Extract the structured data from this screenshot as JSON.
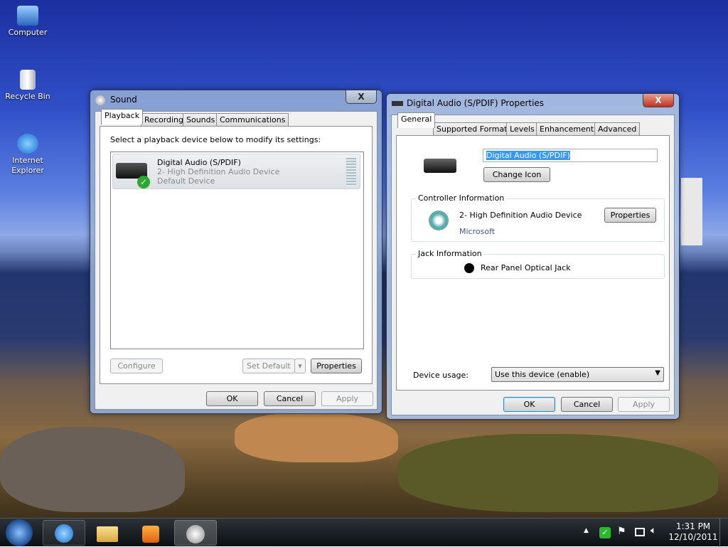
{
  "desktop": {
    "icons": [
      {
        "label": "Computer",
        "icon": "computer-icon"
      },
      {
        "label": "Recycle Bin",
        "icon": "recycle-bin-icon"
      },
      {
        "label": "Internet Explorer",
        "icon": "internet-explorer-icon"
      }
    ]
  },
  "sound": {
    "title": "Sound",
    "close": "X",
    "tabs": [
      "Playback",
      "Recording",
      "Sounds",
      "Communications"
    ],
    "instruction": "Select a playback device below to modify its settings:",
    "device": {
      "name": "Digital Audio (S/PDIF)",
      "driver": "2- High Definition Audio Device",
      "status": "Default Device"
    },
    "configure": "Configure",
    "set_default": "Set Default",
    "properties": "Properties",
    "ok": "OK",
    "cancel": "Cancel",
    "apply": "Apply"
  },
  "props": {
    "title": "Digital Audio (S/PDIF) Properties",
    "close": "X",
    "tabs": [
      "General",
      "Supported Formats",
      "Levels",
      "Enhancements",
      "Advanced"
    ],
    "name_value": "Digital Audio (S/PDIF)",
    "change_icon": "Change Icon",
    "controller": {
      "label": "Controller Information",
      "name": "2- High Definition Audio Device",
      "vendor": "Microsoft",
      "properties": "Properties"
    },
    "jack": {
      "label": "Jack Information",
      "value": "Rear Panel Optical Jack"
    },
    "usage_label": "Device usage:",
    "usage_value": "Use this device (enable)",
    "ok": "OK",
    "cancel": "Cancel",
    "apply": "Apply"
  },
  "taskbar": {
    "time": "1:31 PM",
    "date": "12/10/2011",
    "pinned": [
      "start-orb",
      "internet-explorer",
      "windows-explorer",
      "media-player",
      "sound"
    ]
  }
}
